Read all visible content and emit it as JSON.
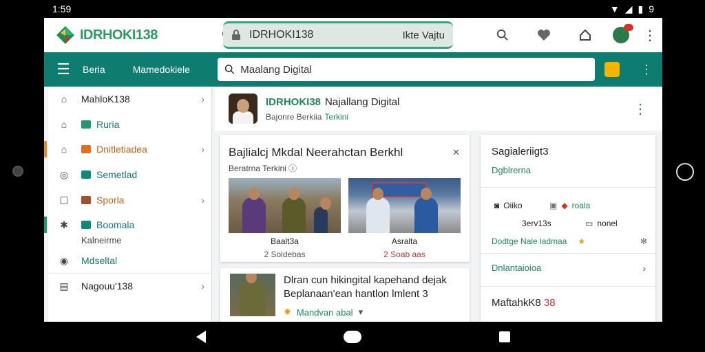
{
  "status": {
    "time": "1:59",
    "battery": "9"
  },
  "header": {
    "brand": "IDRHOKI138",
    "url": "IDRHOKI138",
    "url_right": "Ikte Vajtu"
  },
  "nav": {
    "links": [
      "Beria",
      "Mamedokiele"
    ],
    "search_value": "Maalang Digital"
  },
  "sidebar": {
    "items": [
      {
        "label": "MahloK138",
        "icon": "home-icon",
        "chevron": true
      },
      {
        "label": "Ruria",
        "icon": "user-icon",
        "chevron": false,
        "style": "teal"
      },
      {
        "label": "Dnitletiadea",
        "icon": "house-icon",
        "chevron": true,
        "style": "orange"
      },
      {
        "label": "Semetlad",
        "icon": "info-icon",
        "chevron": false,
        "style": "teal"
      },
      {
        "label": "Sporla",
        "icon": "chat-icon",
        "chevron": true,
        "style": "orange"
      },
      {
        "label": "Boomala",
        "icon": "tools-icon",
        "chevron": false,
        "style": "teal"
      }
    ],
    "sub": "Kalneirme",
    "items2": [
      {
        "label": "Mdseltal",
        "icon": "circle-icon",
        "style": "teal"
      },
      {
        "label": "Nagouu'138",
        "icon": "list-icon",
        "chevron": true
      }
    ]
  },
  "page": {
    "title_brand": "IDRHOKI38",
    "title": "Najallang Digital",
    "subtitle": "Bajonre Berkiia",
    "subtitle_accent": "Terkini"
  },
  "card1": {
    "title": "Bajlialcj Mkdal Neerahctan Berkhl",
    "subtitle": "Beratrna Terkini",
    "captions": [
      "Baalt3a",
      "Asralta"
    ],
    "subcaptions": [
      "2 Soldebas",
      "2 Soab aas"
    ]
  },
  "card2": {
    "text": "Dlran cun hikingital kapehand dejak Beplanaan'ean hantlon lmlent 3",
    "meta": "Mandvan abal"
  },
  "card3": {
    "title": "Sagialeriigt3",
    "subtitle": "Dgblrerna",
    "row1_left": "Oiiko",
    "row1_right": "roala",
    "row2_left": "3erv13s",
    "row2_right": "nonel",
    "row3": "Dodtge Nale ladmaa",
    "link": "Dnlantaioioa",
    "bottom": "MaftahkK8 ",
    "bottom_accent": "38"
  }
}
